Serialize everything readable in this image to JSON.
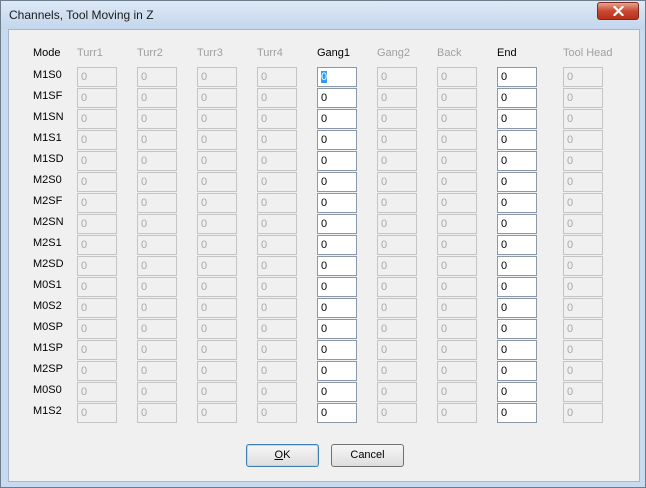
{
  "window": {
    "title": "Channels, Tool Moving in Z"
  },
  "columns": [
    {
      "label": "Mode",
      "active": true
    },
    {
      "label": "Turr1",
      "active": false
    },
    {
      "label": "Turr2",
      "active": false
    },
    {
      "label": "Turr3",
      "active": false
    },
    {
      "label": "Turr4",
      "active": false
    },
    {
      "label": "Gang1",
      "active": true
    },
    {
      "label": "Gang2",
      "active": false
    },
    {
      "label": "Back",
      "active": false
    },
    {
      "label": "End",
      "active": true
    },
    {
      "label": "Tool Head",
      "active": false
    }
  ],
  "rows": [
    {
      "mode": "M1S0",
      "values": [
        "0",
        "0",
        "0",
        "0",
        "0",
        "0",
        "0",
        "0",
        "0"
      ]
    },
    {
      "mode": "M1SF",
      "values": [
        "0",
        "0",
        "0",
        "0",
        "0",
        "0",
        "0",
        "0",
        "0"
      ]
    },
    {
      "mode": "M1SN",
      "values": [
        "0",
        "0",
        "0",
        "0",
        "0",
        "0",
        "0",
        "0",
        "0"
      ]
    },
    {
      "mode": "M1S1",
      "values": [
        "0",
        "0",
        "0",
        "0",
        "0",
        "0",
        "0",
        "0",
        "0"
      ]
    },
    {
      "mode": "M1SD",
      "values": [
        "0",
        "0",
        "0",
        "0",
        "0",
        "0",
        "0",
        "0",
        "0"
      ]
    },
    {
      "mode": "M2S0",
      "values": [
        "0",
        "0",
        "0",
        "0",
        "0",
        "0",
        "0",
        "0",
        "0"
      ]
    },
    {
      "mode": "M2SF",
      "values": [
        "0",
        "0",
        "0",
        "0",
        "0",
        "0",
        "0",
        "0",
        "0"
      ]
    },
    {
      "mode": "M2SN",
      "values": [
        "0",
        "0",
        "0",
        "0",
        "0",
        "0",
        "0",
        "0",
        "0"
      ]
    },
    {
      "mode": "M2S1",
      "values": [
        "0",
        "0",
        "0",
        "0",
        "0",
        "0",
        "0",
        "0",
        "0"
      ]
    },
    {
      "mode": "M2SD",
      "values": [
        "0",
        "0",
        "0",
        "0",
        "0",
        "0",
        "0",
        "0",
        "0"
      ]
    },
    {
      "mode": "M0S1",
      "values": [
        "0",
        "0",
        "0",
        "0",
        "0",
        "0",
        "0",
        "0",
        "0"
      ]
    },
    {
      "mode": "M0S2",
      "values": [
        "0",
        "0",
        "0",
        "0",
        "0",
        "0",
        "0",
        "0",
        "0"
      ]
    },
    {
      "mode": "M0SP",
      "values": [
        "0",
        "0",
        "0",
        "0",
        "0",
        "0",
        "0",
        "0",
        "0"
      ]
    },
    {
      "mode": "M1SP",
      "values": [
        "0",
        "0",
        "0",
        "0",
        "0",
        "0",
        "0",
        "0",
        "0"
      ]
    },
    {
      "mode": "M2SP",
      "values": [
        "0",
        "0",
        "0",
        "0",
        "0",
        "0",
        "0",
        "0",
        "0"
      ]
    },
    {
      "mode": "M0S0",
      "values": [
        "0",
        "0",
        "0",
        "0",
        "0",
        "0",
        "0",
        "0",
        "0"
      ]
    },
    {
      "mode": "M1S2",
      "values": [
        "0",
        "0",
        "0",
        "0",
        "0",
        "0",
        "0",
        "0",
        "0"
      ]
    }
  ],
  "buttons": {
    "ok": {
      "prefix": "",
      "mnemonic": "O",
      "suffix": "K"
    },
    "cancel": "Cancel"
  },
  "colors": {
    "enabled_text": "#000000",
    "disabled_text": "#a0a0a0",
    "selection": "#3399ff"
  },
  "icons": {
    "close": "close-icon"
  }
}
